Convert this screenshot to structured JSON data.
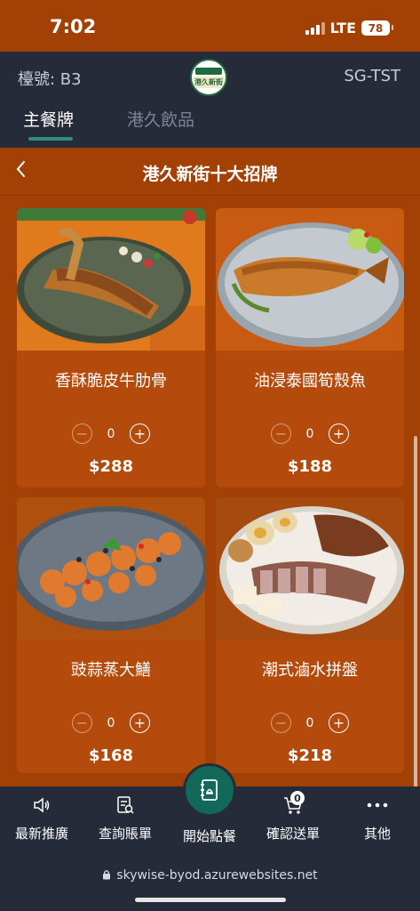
{
  "status_bar": {
    "time": "7:02",
    "network": "LTE",
    "battery": "78"
  },
  "header": {
    "table_label": "檯號: B3",
    "store_code": "SG-TST",
    "logo_text": "港久新街"
  },
  "tabs": [
    {
      "label": "主餐牌",
      "active": true
    },
    {
      "label": "港久飲品",
      "active": false
    }
  ],
  "category": {
    "title": "港久新街十大招牌"
  },
  "items": [
    {
      "name": "香酥脆皮牛肋骨",
      "qty": "0",
      "price": "$288"
    },
    {
      "name": "油浸泰國筍殼魚",
      "qty": "0",
      "price": "$188"
    },
    {
      "name": "豉蒜蒸大鱔",
      "qty": "0",
      "price": "$168"
    },
    {
      "name": "潮式滷水拼盤",
      "qty": "0",
      "price": "$218"
    }
  ],
  "bottom_nav": [
    {
      "label": "最新推廣",
      "icon": "speaker-icon"
    },
    {
      "label": "查詢賬單",
      "icon": "bill-search-icon"
    },
    {
      "label": "開始點餐",
      "icon": "order-book-icon"
    },
    {
      "label": "確認送單",
      "icon": "cart-icon",
      "badge": "0"
    },
    {
      "label": "其他",
      "icon": "more-icon"
    }
  ],
  "browser": {
    "url": "skywise-byod.azurewebsites.net"
  },
  "colors": {
    "primary": "#a34006",
    "header": "#262b3a",
    "accent": "#2f8f76",
    "fab": "#12695a"
  }
}
